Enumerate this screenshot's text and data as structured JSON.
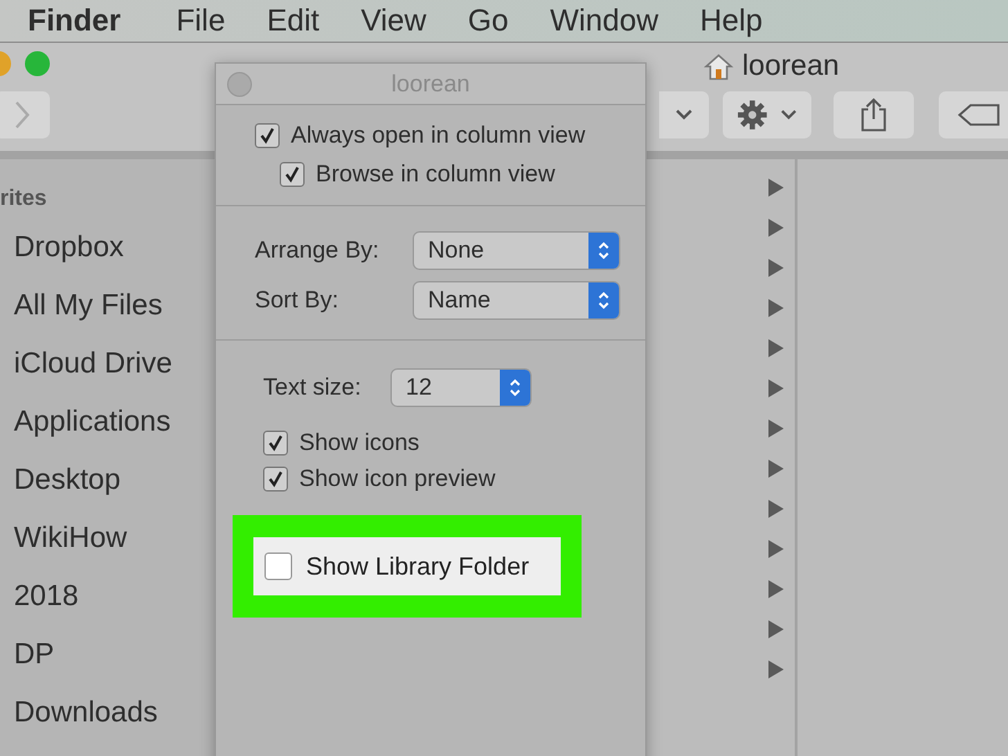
{
  "menu_bar": {
    "items": [
      {
        "label": "Finder",
        "kind": "app"
      },
      {
        "label": "File",
        "kind": "menu"
      },
      {
        "label": "Edit",
        "kind": "menu"
      },
      {
        "label": "View",
        "kind": "menu"
      },
      {
        "label": "Go",
        "kind": "menu"
      },
      {
        "label": "Window",
        "kind": "menu"
      },
      {
        "label": "Help",
        "kind": "menu"
      }
    ]
  },
  "window": {
    "title": "loorean"
  },
  "sidebar": {
    "header": "rites",
    "items": [
      "Dropbox",
      "All My Files",
      "iCloud Drive",
      "Applications",
      "Desktop",
      "WikiHow",
      "2018",
      "DP",
      "Downloads"
    ]
  },
  "view_options": {
    "title": "loorean",
    "column_options": [
      {
        "label": "Always open in column view",
        "checked": true
      },
      {
        "label": "Browse in column view",
        "checked": true
      }
    ],
    "popups": [
      {
        "label": "Arrange By:",
        "value": "None"
      },
      {
        "label": "Sort By:",
        "value": "Name"
      }
    ],
    "text_size": {
      "label": "Text size:",
      "value": "12"
    },
    "display_options": [
      {
        "label": "Show icons",
        "checked": true
      },
      {
        "label": "Show icon preview",
        "checked": true
      }
    ],
    "highlighted_option": {
      "label": "Show Library Folder",
      "checked": false
    }
  }
}
